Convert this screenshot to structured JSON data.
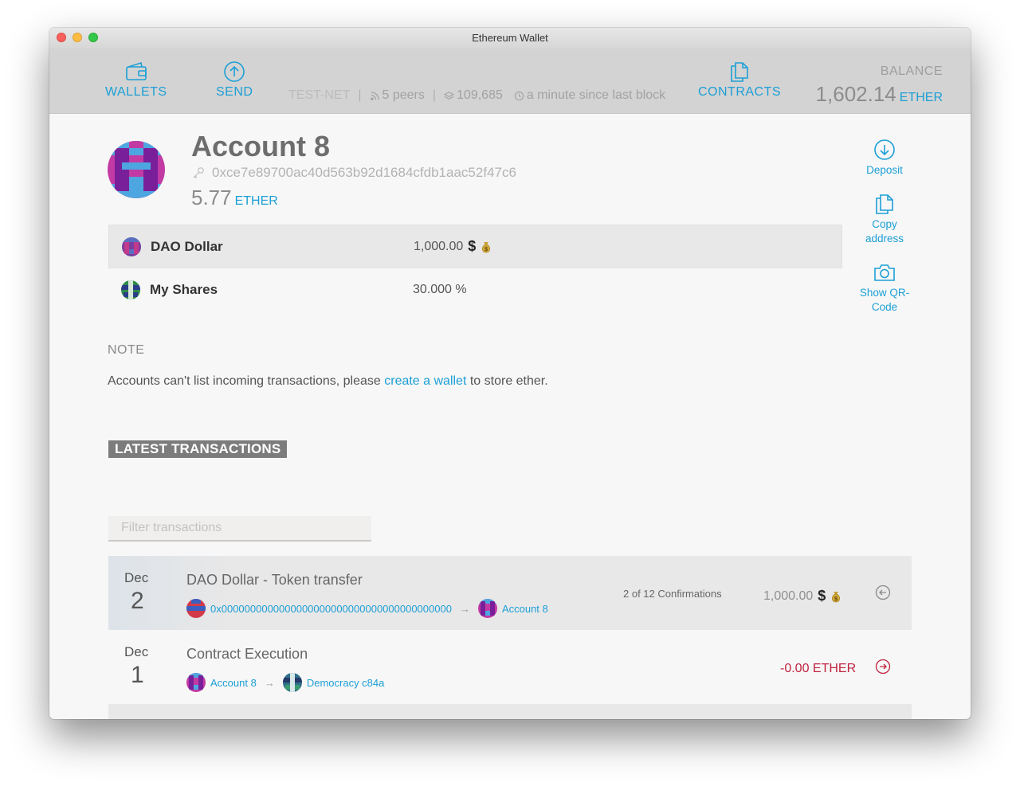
{
  "window": {
    "title": "Ethereum Wallet"
  },
  "header": {
    "wallets_label": "WALLETS",
    "send_label": "SEND",
    "network": "TEST-NET",
    "peers": "5 peers",
    "block": "109,685",
    "last_block": "a minute since last block",
    "contracts_label": "CONTRACTS",
    "balance_label": "BALANCE",
    "balance_value": "1,602.14",
    "balance_unit": "ETHER"
  },
  "account": {
    "name": "Account 8",
    "address": "0xce7e89700ac40d563b92d1684cfdb1aac52f47c6",
    "balance": "5.77",
    "unit": "ETHER"
  },
  "tokens": [
    {
      "name": "DAO Dollar",
      "value": "1,000.00",
      "symbol": "$",
      "bag_icon": "money-bag-icon"
    },
    {
      "name": "My Shares",
      "value": "30.000 %"
    }
  ],
  "actions": {
    "deposit": "Deposit",
    "copy": "Copy address",
    "qr": "Show QR-Code"
  },
  "note": {
    "title": "NOTE",
    "text_before": "Accounts can't list incoming transactions, please ",
    "link": "create a wallet",
    "text_after": " to store ether."
  },
  "latest_label": "LATEST TRANSACTIONS",
  "filter": {
    "placeholder": "Filter transactions"
  },
  "transactions": [
    {
      "month": "Dec",
      "day": "2",
      "title": "DAO Dollar - Token transfer",
      "from": "0x0000000000000000000000000000000000000000",
      "to": "Account 8",
      "confirmations": "2 of 12 Confirmations",
      "amount": "1,000.00",
      "symbol": "$"
    },
    {
      "month": "Dec",
      "day": "1",
      "title": "Contract Execution",
      "from": "Account 8",
      "to": "Democracy c84a",
      "amount": "-0.00 ETHER"
    }
  ],
  "colors": {
    "accent": "#1c9fd6",
    "negative": "#c0233f",
    "header_bg": "#d3d3d3"
  }
}
